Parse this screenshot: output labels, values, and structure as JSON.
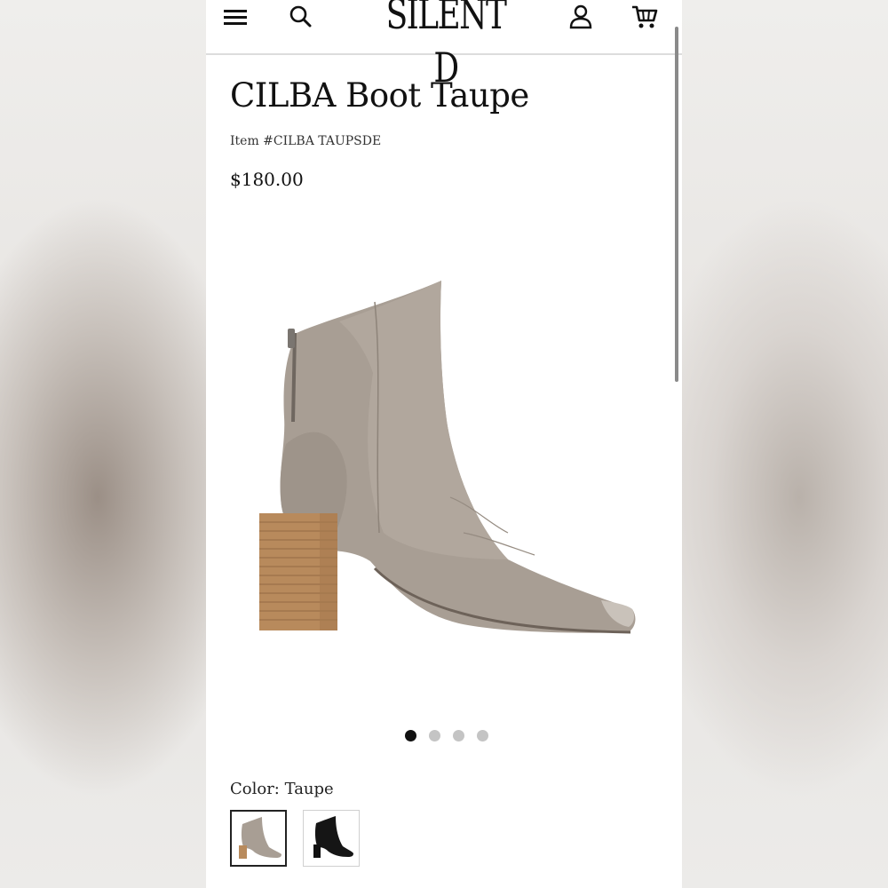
{
  "header": {
    "logo_text": "SILENT D",
    "icons": [
      "menu-icon",
      "search-icon",
      "account-icon",
      "cart-icon"
    ]
  },
  "product": {
    "title": "CILBA Boot Taupe",
    "item_number": "Item #CILBA TAUPSDE",
    "price": "$180.00",
    "image_alt": "CILBA Boot Taupe side view"
  },
  "carousel": {
    "total_slides": 4,
    "active_slide": 1
  },
  "color": {
    "label": "Color: Taupe",
    "options": [
      {
        "name": "Taupe",
        "selected": true,
        "swatch": "#a79c91"
      },
      {
        "name": "Black",
        "selected": false,
        "swatch": "#151515"
      }
    ]
  },
  "colors": {
    "suede_taupe": "#a89e94",
    "heel_wood": "#b88a5c",
    "dot_active": "#111111",
    "dot_inactive": "#c4c4c4"
  }
}
